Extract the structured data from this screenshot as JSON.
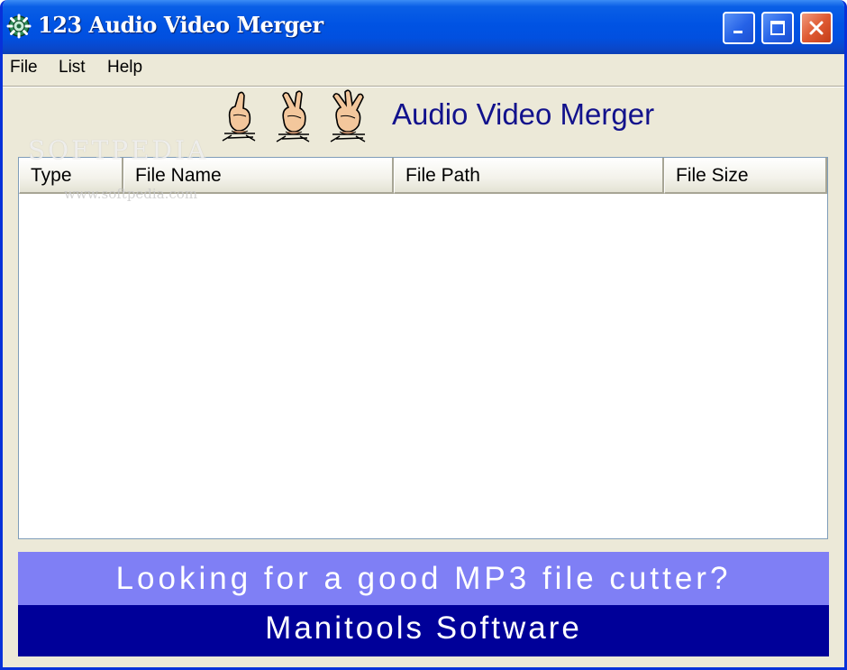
{
  "window": {
    "title": "123 Audio Video Merger",
    "icons": {
      "app": "app-gear-icon",
      "minimize": "minimize-icon",
      "maximize": "maximize-icon",
      "close": "close-icon"
    }
  },
  "menu": [
    {
      "label": "File"
    },
    {
      "label": "List"
    },
    {
      "label": "Help"
    }
  ],
  "header": {
    "title": "Audio Video Merger",
    "icon": "counting-hands-icon"
  },
  "watermark": {
    "text": "SOFTPEDIA",
    "url": "www.softpedia.com"
  },
  "table": {
    "columns": [
      "Type",
      "File Name",
      "File Path",
      "File Size"
    ],
    "rows": []
  },
  "banner": {
    "line1": "Looking for a good MP3 file cutter?",
    "line2": "Manitools Software"
  },
  "colors": {
    "title_bar": "#0053e3",
    "header_text": "#12128c",
    "banner_light": "#7f7ff5",
    "banner_dark": "#000099",
    "window_bg": "#ece9d8"
  }
}
